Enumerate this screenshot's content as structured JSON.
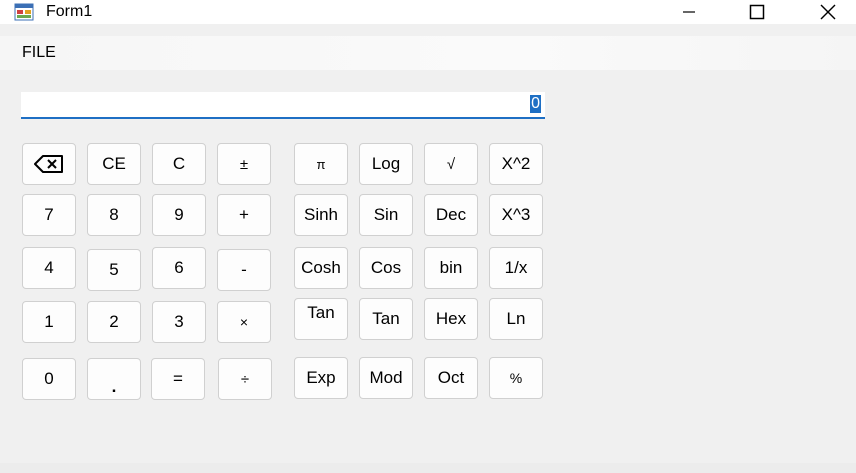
{
  "window": {
    "title": "Form1"
  },
  "menu": {
    "file": "FILE"
  },
  "display": {
    "value": "0"
  },
  "keys": {
    "ce": "CE",
    "c": "C",
    "plusminus": "±",
    "pi": "π",
    "log": "Log",
    "sqrt": "√",
    "x2": "X^2",
    "k7": "7",
    "k8": "8",
    "k9": "9",
    "plus": "+",
    "sinh": "Sinh",
    "sin": "Sin",
    "dec": "Dec",
    "x3": "X^3",
    "k4": "4",
    "k5": "5",
    "k6": "6",
    "minus": "-",
    "cosh": "Cosh",
    "cos": "Cos",
    "bin": "bin",
    "inv": "1/x",
    "k1": "1",
    "k2": "2",
    "k3": "3",
    "mul": "×",
    "tanh": "Tan",
    "tan": "Tan",
    "hex": "Hex",
    "ln": "Ln",
    "k0": "0",
    "dot": ".",
    "eq": "=",
    "div": "÷",
    "exp": "Exp",
    "mod": "Mod",
    "oct": "Oct",
    "pct": "%"
  },
  "icons": {
    "app": "app-icon",
    "minimize": "minimize-icon",
    "maximize": "maximize-icon",
    "close": "close-icon",
    "backspace": "backspace-icon"
  }
}
